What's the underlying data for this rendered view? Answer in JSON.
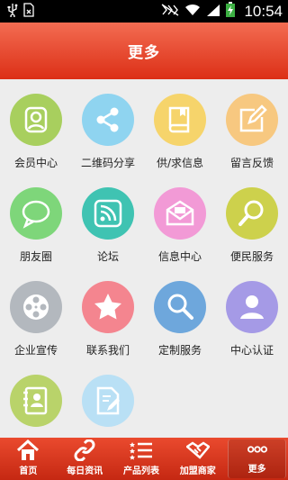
{
  "status_bar": {
    "time": "10:54",
    "icons": [
      "usb-icon",
      "sim-icon",
      "mute-icon",
      "wifi-icon",
      "signal-icon",
      "battery-charging-icon"
    ]
  },
  "header": {
    "title": "更多"
  },
  "grid": {
    "items": [
      {
        "label": "会员中心",
        "icon": "user-icon",
        "color": "#a8cf5e"
      },
      {
        "label": "二维码分享",
        "icon": "share-icon",
        "color": "#8fd4f0"
      },
      {
        "label": "供/求信息",
        "icon": "book-icon",
        "color": "#f6d46b"
      },
      {
        "label": "留言反馈",
        "icon": "edit-icon",
        "color": "#f7c880"
      },
      {
        "label": "朋友圈",
        "icon": "chat-bubble-icon",
        "color": "#7ed67a"
      },
      {
        "label": "论坛",
        "icon": "rss-icon",
        "color": "#3fc3b2"
      },
      {
        "label": "信息中心",
        "icon": "envelope-icon",
        "color": "#f29ad6"
      },
      {
        "label": "便民服务",
        "icon": "search-icon",
        "color": "#cdd14c"
      },
      {
        "label": "企业宣传",
        "icon": "film-reel-icon",
        "color": "#b3b8be"
      },
      {
        "label": "联系我们",
        "icon": "star-icon",
        "color": "#f4858f"
      },
      {
        "label": "定制服务",
        "icon": "magnifier-icon",
        "color": "#6ea7dc"
      },
      {
        "label": "中心认证",
        "icon": "person-badge-icon",
        "color": "#a59ae6"
      },
      {
        "label": "",
        "icon": "contacts-icon",
        "color": "#b9d36a"
      },
      {
        "label": "",
        "icon": "document-edit-icon",
        "color": "#b9e0f5"
      }
    ]
  },
  "tab_bar": {
    "tabs": [
      {
        "label": "首页",
        "icon": "home-icon"
      },
      {
        "label": "每日资讯",
        "icon": "link-icon"
      },
      {
        "label": "产品列表",
        "icon": "list-icon"
      },
      {
        "label": "加盟商家",
        "icon": "handshake-icon"
      },
      {
        "label": "更多",
        "icon": "more-dots-icon",
        "active": true
      }
    ]
  }
}
